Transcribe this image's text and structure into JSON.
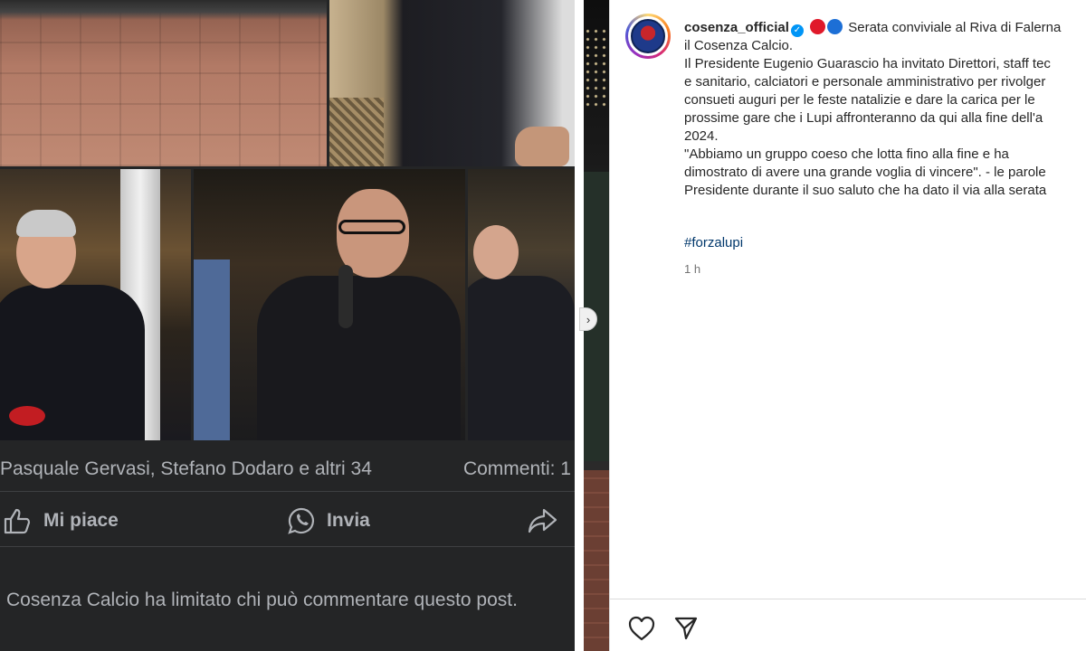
{
  "facebook": {
    "reactions_text": "Pasquale Gervasi, Stefano Dodaro e altri 34",
    "comments_text": "Commenti: 1",
    "actions": {
      "like": "Mi piace",
      "send": "Invia"
    },
    "restricted_text": "Cosenza Calcio ha limitato chi può commentare questo post."
  },
  "instagram": {
    "username": "cosenza_official",
    "caption_lines": [
      "Serata conviviale al Riva di Falerna",
      "il Cosenza Calcio.",
      "Il Presidente Eugenio Guarascio ha invitato Direttori, staff tec",
      "e sanitario, calciatori e personale amministrativo per rivolger",
      "consueti auguri per le feste natalizie e dare la carica per le",
      "prossime gare che i Lupi affronteranno da qui alla fine dell'a",
      "2024.",
      "\"Abbiamo un gruppo coeso che lotta fino alla fine e ha",
      "dimostrato di avere una grande voglia di vincere\". - le parole",
      "Presidente durante il suo saluto che ha dato il via alla serata"
    ],
    "hashtag": "#forzalupi",
    "timestamp": "1 h",
    "colors": {
      "red_dot": "#e0192a",
      "blue_dot": "#1d6fd6",
      "verified": "#0095f6"
    },
    "icons": [
      "heart-icon",
      "send-icon"
    ]
  }
}
